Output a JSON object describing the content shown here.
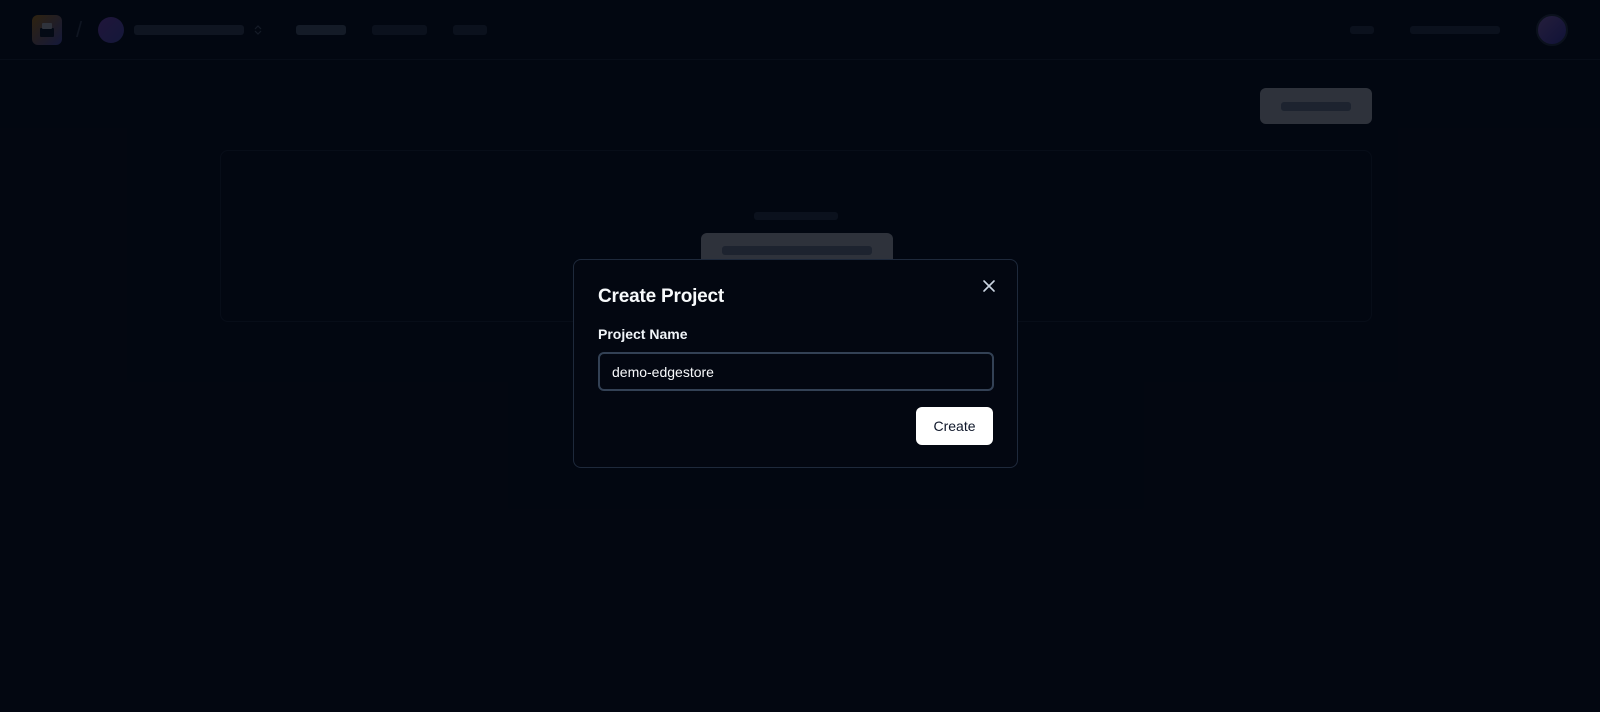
{
  "dialog": {
    "title": "Create Project",
    "field_label": "Project Name",
    "input_value": "demo-edgestore",
    "create_label": "Create"
  },
  "icons": {
    "close": "close-icon",
    "logo": "edgestore-logo-icon",
    "chevron": "chevron-up-down-icon"
  },
  "colors": {
    "background": "#030711",
    "border": "#1e293b",
    "primary_button": "#ffffff"
  }
}
